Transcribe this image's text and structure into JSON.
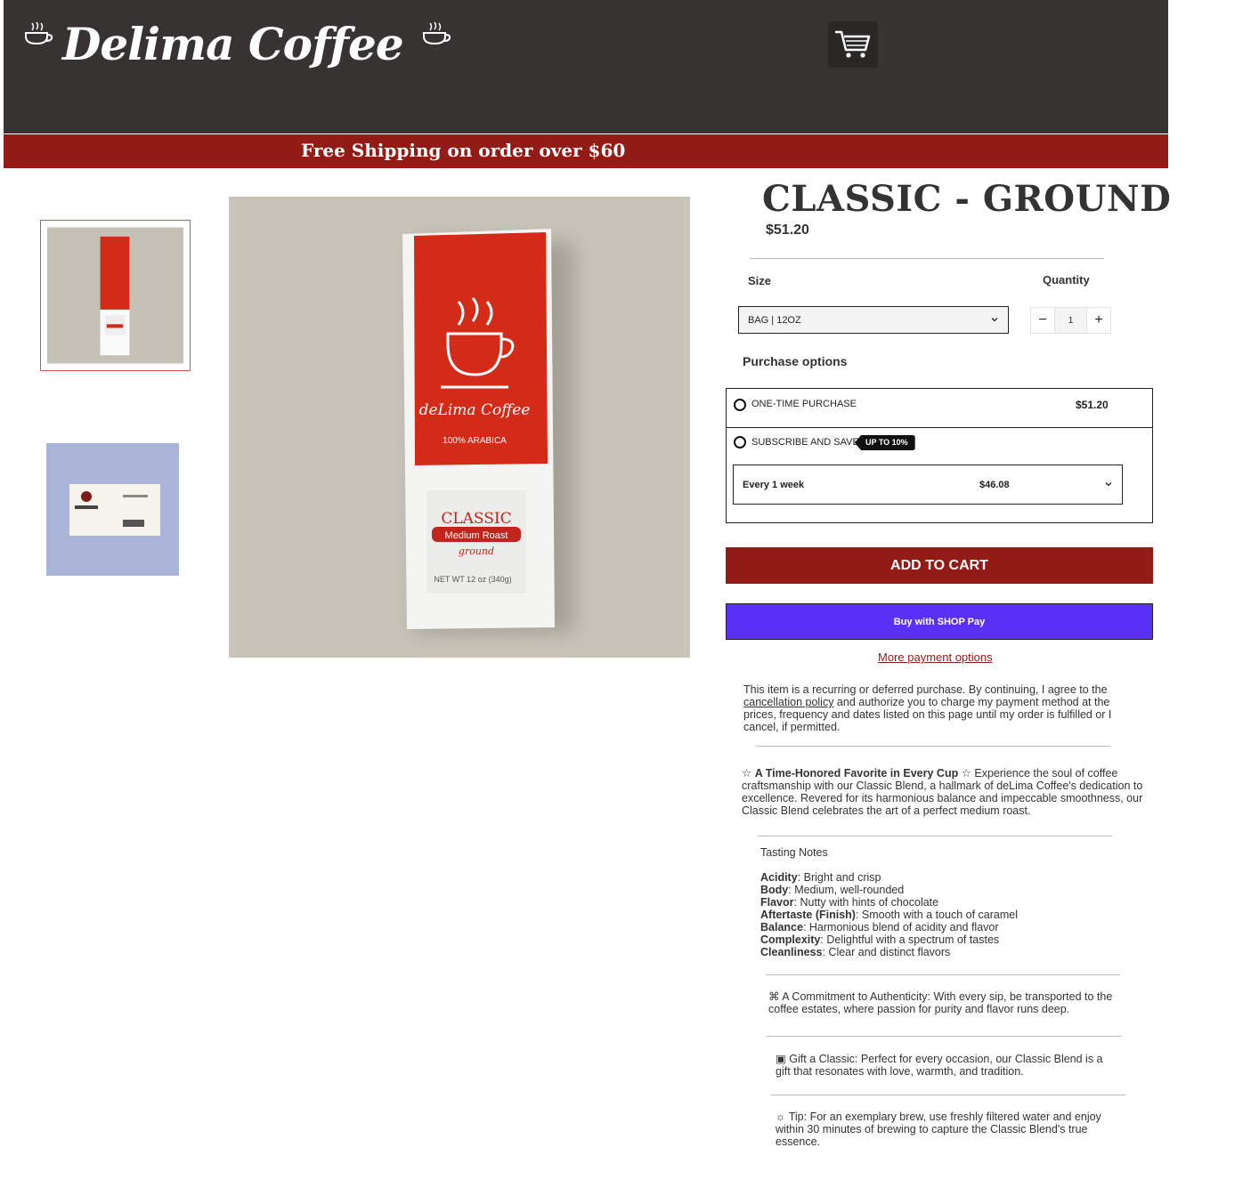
{
  "header": {
    "brand": "Delima Coffee",
    "announcement": "Free Shipping on order over $60"
  },
  "product": {
    "title": "CLASSIC - GROUND",
    "price": "$51.20",
    "size_label": "Size",
    "size_value": "BAG | 12OZ",
    "quantity_label": "Quantity",
    "quantity_value": "1"
  },
  "packaging": {
    "brand": "deLima Coffee",
    "arabica": "100% ARABICA",
    "name": "CLASSIC",
    "roast": "Medium Roast",
    "grind": "ground",
    "weight": "NET WT 12 oz (340g)"
  },
  "purchase": {
    "heading": "Purchase options",
    "one_time_label": "ONE-TIME PURCHASE",
    "one_time_price": "$51.20",
    "subscribe_label": "SUBSCRIBE AND SAVE",
    "subscribe_badge": "UP TO 10%",
    "frequency_label": "Every 1 week",
    "frequency_price": "$46.08"
  },
  "actions": {
    "add_to_cart": "ADD TO CART",
    "shop_pay": "Buy with SHOP Pay",
    "more_payment": "More payment options"
  },
  "disclaimer": {
    "before": "This item is a recurring or deferred purchase. By continuing, I agree to the ",
    "link": "cancellation policy",
    "after": " and authorize you to charge my payment method at the prices, frequency and dates listed on this page until my order is fulfilled or I cancel, if permitted."
  },
  "description": {
    "intro_bold": "A Time-Honored Favorite in Every Cup",
    "intro_text": " Experience the soul of coffee craftsmanship with our Classic Blend, a hallmark of deLima Coffee's dedication to excellence. Revered for its harmonious balance and impeccable smoothness, our Classic Blend celebrates the art of a perfect medium roast.",
    "tasting_title": "Tasting Notes",
    "notes": [
      {
        "term": "Acidity",
        "text": ": Bright and crisp"
      },
      {
        "term": "Body",
        "text": ": Medium, well-rounded"
      },
      {
        "term": "Flavor",
        "text": ": Nutty with hints of chocolate"
      },
      {
        "term": "Aftertaste (Finish)",
        "text": ": Smooth with a touch of caramel"
      },
      {
        "term": "Balance",
        "text": ": Harmonious blend of acidity and flavor"
      },
      {
        "term": "Complexity",
        "text": ": Delightful with a spectrum of tastes"
      },
      {
        "term": "Cleanliness",
        "text": ": Clear and distinct flavors"
      }
    ],
    "authenticity": "A Commitment to Authenticity: With every sip, be transported to the coffee estates, where passion for purity and flavor runs deep.",
    "gift": "Gift a Classic: Perfect for every occasion, our Classic Blend is a gift that resonates with love, warmth, and tradition.",
    "tip": "Tip: For an exemplary brew, use freshly filtered water and enjoy within 30 minutes of brewing to capture the Classic Blend's true essence."
  },
  "colors": {
    "header_bg": "#363332",
    "brand_red": "#921b15",
    "shop_pay": "#5a31f4"
  }
}
